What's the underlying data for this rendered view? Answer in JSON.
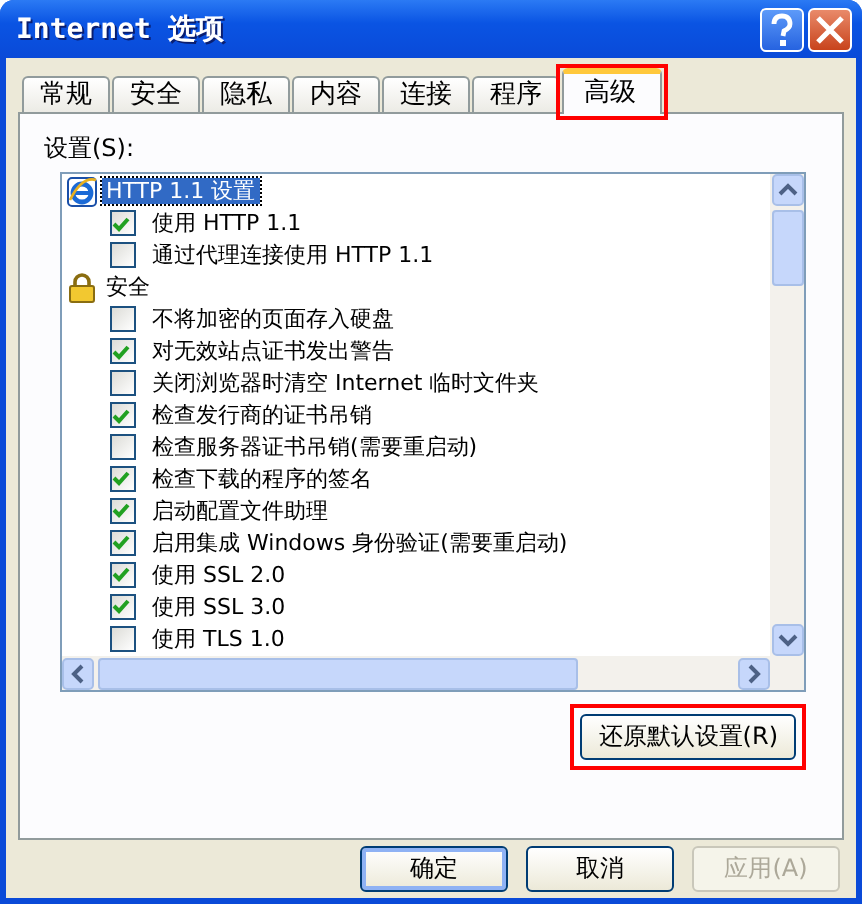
{
  "window": {
    "title": "Internet 选项"
  },
  "tabs": [
    {
      "label": "常规",
      "selected": false,
      "highlighted": false
    },
    {
      "label": "安全",
      "selected": false,
      "highlighted": false
    },
    {
      "label": "隐私",
      "selected": false,
      "highlighted": false
    },
    {
      "label": "内容",
      "selected": false,
      "highlighted": false
    },
    {
      "label": "连接",
      "selected": false,
      "highlighted": false
    },
    {
      "label": "程序",
      "selected": false,
      "highlighted": false
    },
    {
      "label": "高级",
      "selected": true,
      "highlighted": true
    }
  ],
  "settings": {
    "label": "设置(S):",
    "items": [
      {
        "label": "HTTP 1.1 设置",
        "selected": true,
        "children": [
          {
            "label": "使用 HTTP 1.1",
            "checked": true,
            "selected": false
          },
          {
            "label": "通过代理连接使用 HTTP 1.1",
            "checked": false,
            "selected": false
          }
        ]
      },
      {
        "label": "安全",
        "selected": false,
        "children": [
          {
            "label": "不将加密的页面存入硬盘",
            "checked": false,
            "selected": false
          },
          {
            "label": "对无效站点证书发出警告",
            "checked": true,
            "selected": false
          },
          {
            "label": "关闭浏览器时清空 Internet 临时文件夹",
            "checked": false,
            "selected": false
          },
          {
            "label": "检查发行商的证书吊销",
            "checked": true,
            "selected": false
          },
          {
            "label": "检查服务器证书吊销(需要重启动)",
            "checked": false,
            "selected": false
          },
          {
            "label": "检查下载的程序的签名",
            "checked": true,
            "selected": false
          },
          {
            "label": "启动配置文件助理",
            "checked": true,
            "selected": false
          },
          {
            "label": "启用集成 Windows 身份验证(需要重启动)",
            "checked": true,
            "selected": false
          },
          {
            "label": "使用 SSL 2.0",
            "checked": true,
            "selected": false
          },
          {
            "label": "使用 SSL 3.0",
            "checked": true,
            "selected": false
          },
          {
            "label": "使用 TLS 1.0",
            "checked": false,
            "selected": false
          }
        ]
      }
    ]
  },
  "restore_button": {
    "label": "还原默认设置(R)",
    "highlighted": true
  },
  "buttons": [
    {
      "label": "确定",
      "disabled": false,
      "default": true
    },
    {
      "label": "取消",
      "disabled": false,
      "default": false
    },
    {
      "label": "应用(A)",
      "disabled": true,
      "default": false
    }
  ]
}
